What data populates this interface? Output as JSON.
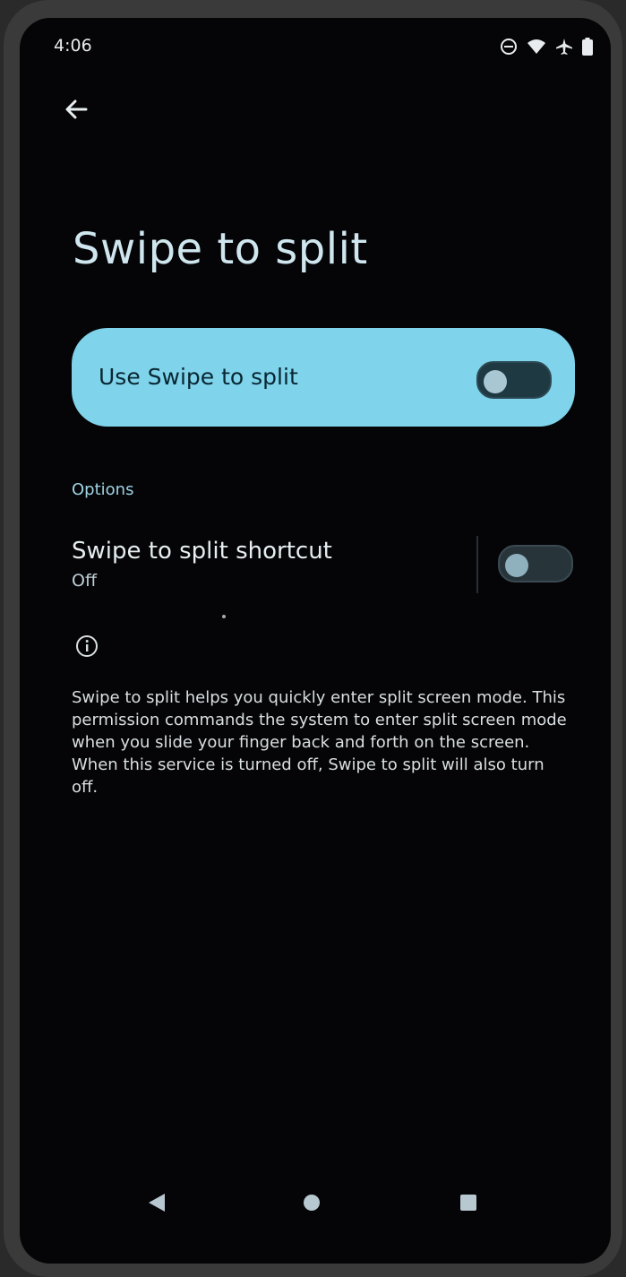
{
  "status_bar": {
    "time": "4:06",
    "icons": [
      "do-not-disturb-icon",
      "wifi-icon",
      "airplane-icon",
      "battery-icon"
    ]
  },
  "header": {
    "back_icon": "arrow-left-icon",
    "title": "Swipe to split"
  },
  "main_toggle": {
    "label": "Use Swipe to split",
    "state": "off"
  },
  "options": {
    "section_label": "Options",
    "shortcut": {
      "title": "Swipe to split shortcut",
      "subtitle": "Off",
      "state": "off"
    }
  },
  "info": {
    "icon": "info-icon",
    "text": "Swipe to split helps you quickly enter split screen mode. This permission commands the system to enter split screen mode when you slide your finger back and forth on the screen. When this service is turned off, Swipe to split will also turn off."
  },
  "nav_bar": {
    "buttons": [
      "back-triangle-icon",
      "home-circle-icon",
      "recents-square-icon"
    ]
  },
  "colors": {
    "background": "#050507",
    "accent": "#7fd3ea",
    "title_text": "#cfe6ee"
  }
}
